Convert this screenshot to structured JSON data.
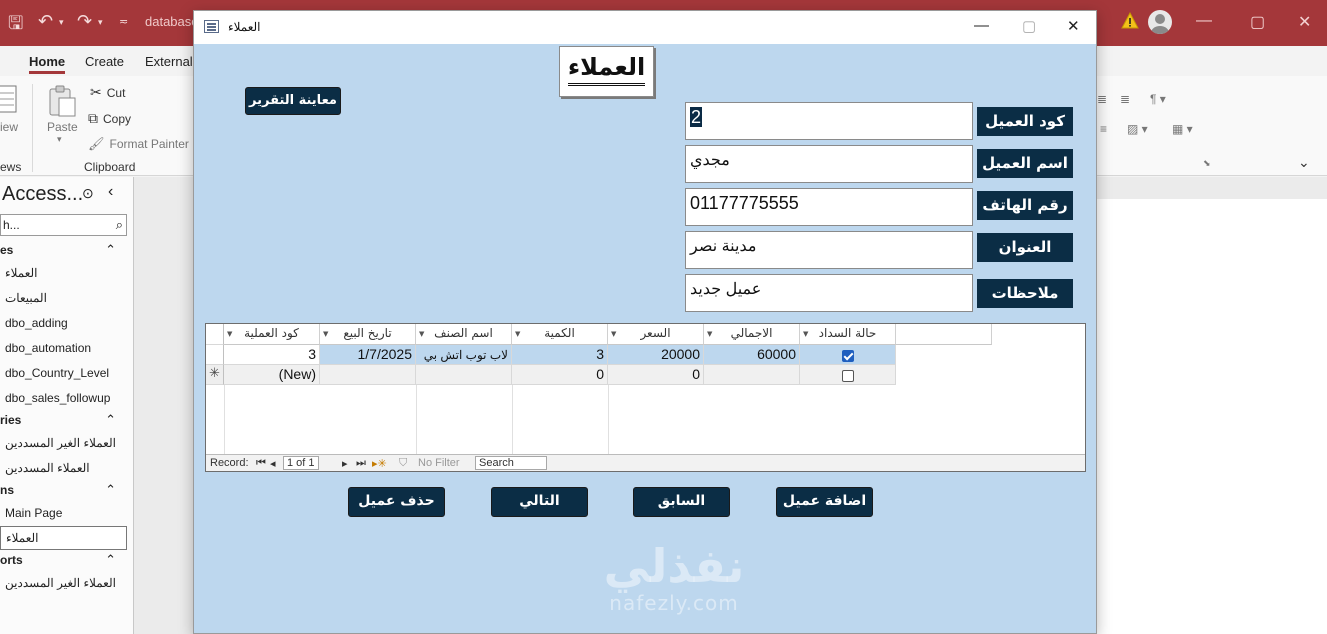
{
  "app": {
    "database_title": "database",
    "title_controls": [
      "—",
      "▢",
      "✕"
    ]
  },
  "ribbon": {
    "tabs": [
      "Home",
      "Create",
      "External"
    ],
    "views_label": "ews",
    "view_label": "iew",
    "paste_label": "Paste",
    "cut_label": "Cut",
    "copy_label": "Copy",
    "format_painter_label": "Format Painter",
    "clipboard_group": "Clipboard"
  },
  "nav": {
    "title": "Access...",
    "search_placeholder": "h...",
    "sections": [
      {
        "label": "es"
      },
      {
        "label": "ries"
      },
      {
        "label": "ns"
      },
      {
        "label": "orts"
      }
    ],
    "tables": [
      "العملاء",
      "المبيعات",
      "dbo_adding",
      "dbo_automation",
      "dbo_Country_Level",
      "dbo_sales_followup"
    ],
    "queries": [
      "العملاء الغير المسددين",
      "العملاء المسددين"
    ],
    "forms": [
      "Main Page",
      "العملاء"
    ],
    "reports": [
      "العملاء الغير المسددين"
    ]
  },
  "form": {
    "window_title": "العملاء",
    "heading": "العملاء",
    "report_button": "معاينة التقرير",
    "fields": [
      {
        "label": "كود العميل",
        "value": "2"
      },
      {
        "label": "اسم العميل",
        "value": "مجدي"
      },
      {
        "label": "رقم الهاتف",
        "value": "01177775555"
      },
      {
        "label": "العنوان",
        "value": "مدينة نصر"
      },
      {
        "label": "ملاحظات",
        "value": "عميل جديد"
      }
    ],
    "grid": {
      "columns": [
        "حالة السداد",
        "الاجمالي",
        "السعر",
        "الكمية",
        "اسم الصنف",
        "تاريخ البيع",
        "كود العملية"
      ],
      "rows": [
        {
          "paid": true,
          "total": "60000",
          "price": "20000",
          "qty": "3",
          "item": "لاب توب اتش بي",
          "date": "1/7/2025",
          "code": "3"
        },
        {
          "paid": false,
          "total": "",
          "price": "0",
          "qty": "0",
          "item": "",
          "date": "",
          "code": "(New)"
        }
      ],
      "record_label": "Record:",
      "record_position": "1 of 1",
      "filter_label": "No Filter",
      "search_label": "Search"
    },
    "buttons": {
      "delete": "حذف عميل",
      "next": "التالي",
      "previous": "السابق",
      "add": "اضافة عميل"
    }
  },
  "watermark": {
    "arabic": "نفذلي",
    "latin": "nafezly.com"
  },
  "colors": {
    "title_bar": "#a4373a",
    "form_background": "#bdd7ee",
    "button_dark": "#0b2d45"
  }
}
